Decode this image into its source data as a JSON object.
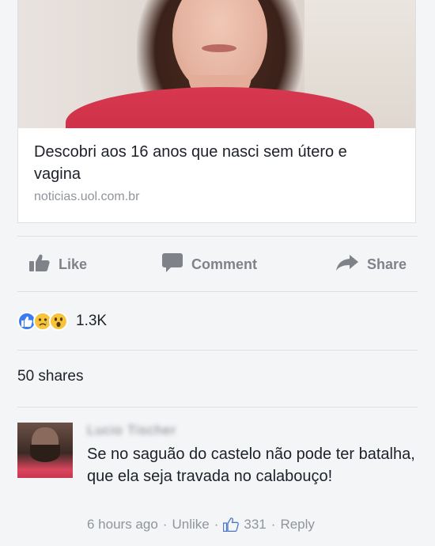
{
  "link_preview": {
    "title": "Descobri aos 16 anos que nasci sem útero e vagina",
    "domain": "noticias.uol.com.br"
  },
  "actions": {
    "like": "Like",
    "comment": "Comment",
    "share": "Share"
  },
  "reactions": {
    "icons": [
      "like-icon",
      "sad-face-icon",
      "wow-face-icon"
    ],
    "count": "1.3K"
  },
  "shares": "50 shares",
  "comment": {
    "author": "Lucio Tischer",
    "text": "Se no saguão do castelo não pode ter batalha, que ela seja travada no calabouço!",
    "time": "6 hours ago",
    "unlike": "Unlike",
    "likes": "331",
    "reply": "Reply"
  },
  "colors": {
    "background": "#f4f5f7",
    "text": "#1d2129",
    "muted": "#90949c",
    "like_blue": "#3b7cf2",
    "reaction_yellow": "#f7c53c"
  }
}
